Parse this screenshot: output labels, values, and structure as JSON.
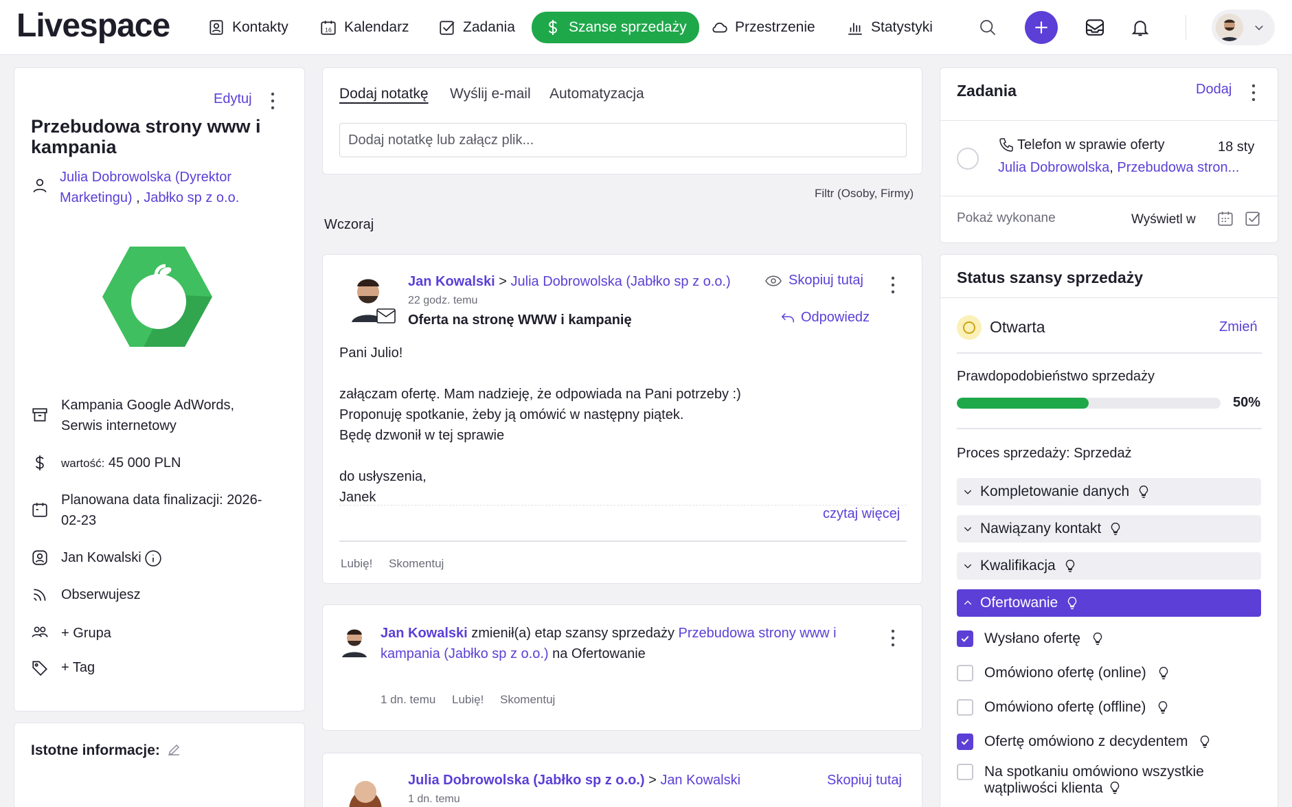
{
  "app": {
    "logo": "Livespace"
  },
  "nav": {
    "contacts": "Kontakty",
    "calendar": "Kalendarz",
    "calendar_day": "16",
    "tasks": "Zadania",
    "deals": "Szanse sprzedaży",
    "spaces": "Przestrzenie",
    "stats": "Statystyki"
  },
  "deal": {
    "edit": "Edytuj",
    "title": "Przebudowa strony www i kampania",
    "contact_person": "Julia Dobrowolska (Dyrektor Marketingu)",
    "contact_sep": " , ",
    "company": "Jabłko sp z o.o.",
    "products": "Kampania Google AdWords, Serwis internetowy",
    "value_label": "wartość:",
    "value": "45 000 PLN",
    "close_date": "Planowana data finalizacji: 2026-02-23",
    "owner": "Jan Kowalski",
    "follow": "Obserwujesz",
    "group": "+ Grupa",
    "tag": "+ Tag"
  },
  "important": {
    "title": "Istotne informacje:"
  },
  "composer": {
    "tabs": [
      "Dodaj notatkę",
      "Wyślij e-mail",
      "Automatyzacja"
    ],
    "placeholder": "Dodaj notatkę lub załącz plik...",
    "filter": "Filtr (Osoby, Firmy)"
  },
  "feed": {
    "day_label": "Wczoraj",
    "email": {
      "from": "Jan Kowalski",
      "arrow": " > ",
      "to": "Julia Dobrowolska (Jabłko sp z o.o.)",
      "time": "22 godz. temu",
      "subject": "Oferta na stronę WWW i kampanię",
      "copy": "Skopiuj tutaj",
      "reply": "Odpowiedz",
      "body": [
        "Pani Julio!",
        "",
        "załączam ofertę. Mam nadzieję, że odpowiada na Pani potrzeby :)",
        "Proponuję spotkanie, żeby ją omówić w następny piątek.",
        "Będę dzwonił w tej sprawie",
        "",
        "do usłyszenia,",
        "Janek"
      ],
      "read_more": "czytaj więcej",
      "like": "Lubię!",
      "comment": "Skomentuj"
    },
    "stage_change": {
      "who": "Jan Kowalski",
      "action": " zmienił(a) etap szansy sprzedaży ",
      "deal_line1": "Przebudowa strony www i",
      "deal_line2": "kampania (Jabłko sp z o.o.)",
      "suffix": " na Ofertowanie",
      "time": "1 dn. temu",
      "like": "Lubię!",
      "comment": "Skomentuj"
    },
    "email2": {
      "from": "Julia Dobrowolska (Jabłko sp z o.o.)",
      "arrow": " > ",
      "to": "Jan Kowalski",
      "time": "1 dn. temu",
      "copy": "Skopiuj tutaj"
    }
  },
  "tasks": {
    "title": "Zadania",
    "add": "Dodaj",
    "item_title": "Telefon w sprawie oferty",
    "item_date": "18 sty",
    "item_person": "Julia Dobrowolska",
    "item_sep": ", ",
    "item_deal": "Przebudowa stron...",
    "show_done": "Pokaż wykonane",
    "view_in": "Wyświetl w"
  },
  "status": {
    "title": "Status szansy sprzedaży",
    "state": "Otwarta",
    "change": "Zmień",
    "prob_label": "Prawdopodobieństwo sprzedaży",
    "prob_value": "50%",
    "prob_fraction": 0.5,
    "process": "Proces sprzedaży: Sprzedaż",
    "stages": [
      "Kompletowanie danych",
      "Nawiązany kontakt",
      "Kwalifikacja",
      "Ofertowanie"
    ],
    "checklist": [
      {
        "label": "Wysłano ofertę",
        "checked": true
      },
      {
        "label": "Omówiono ofertę (online)",
        "checked": false
      },
      {
        "label": "Omówiono ofertę (offline)",
        "checked": false
      },
      {
        "label": "Ofertę omówiono z decydentem",
        "checked": true
      },
      {
        "label": "Na spotkaniu omówiono wszystkie",
        "label2": "wątpliwości klienta",
        "checked": false
      }
    ]
  },
  "colors": {
    "accent": "#5b3fd6",
    "green": "#1fa84a",
    "apple": "#3fbf5f"
  }
}
